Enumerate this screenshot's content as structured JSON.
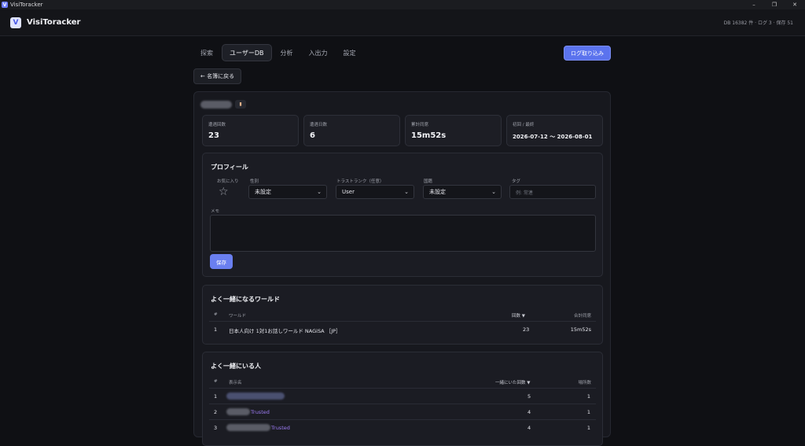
{
  "window": {
    "title": "VisiToracker",
    "controls": [
      "–",
      "❐",
      "✕"
    ]
  },
  "app": {
    "brand": "VisiToracker",
    "logo_letter": "V",
    "db_info": "DB 16382 件 · ログ 3 · 保存 51"
  },
  "nav": {
    "tabs": [
      "探索",
      "ユーザーDB",
      "分析",
      "入出力",
      "設定"
    ],
    "active": "ユーザーDB",
    "import_label": "ログ取り込み"
  },
  "back_label": "← 名簿に戻る",
  "stats": [
    {
      "label": "遭遇回数",
      "value": "23"
    },
    {
      "label": "遭遇日数",
      "value": "6"
    },
    {
      "label": "累計同席",
      "value": "15m52s"
    },
    {
      "label": "初回 / 最終",
      "value": "2026-07-12 〜 2026-08-01"
    }
  ],
  "profile": {
    "title": "プロフィール",
    "favorite_label": "お気に入り",
    "gender_label": "性別",
    "gender_value": "未設定",
    "trust_label": "トラストランク（任意）",
    "trust_value": "User",
    "country_label": "国籍",
    "country_value": "未設定",
    "tag_label": "タグ",
    "tag_placeholder": "例: 常連",
    "memo_label": "メモ",
    "save_label": "保存"
  },
  "worlds": {
    "title": "よく一緒になるワールド",
    "headers": {
      "num": "#",
      "name": "ワールド",
      "count": "回数 ▼",
      "total": "合計同席"
    },
    "rows": [
      {
        "num": "1",
        "name": "日本人向け 1対1お話しワールド NAGiSA ［JP］",
        "count": "23",
        "total": "15m52s"
      }
    ]
  },
  "people": {
    "title": "よく一緒にいる人",
    "headers": {
      "num": "#",
      "name": "表示名",
      "count": "一緒にいた回数 ▼",
      "places": "場所数"
    },
    "rows": [
      {
        "num": "1",
        "suffix": "",
        "count": "5",
        "places": "1"
      },
      {
        "num": "2",
        "suffix": "Trusted",
        "count": "4",
        "places": "1"
      },
      {
        "num": "3",
        "suffix": "Trusted",
        "count": "4",
        "places": "1"
      }
    ]
  },
  "colors": {
    "accent": "#5b73ee",
    "background": "#0f1014",
    "link": "#9d7cf4"
  }
}
